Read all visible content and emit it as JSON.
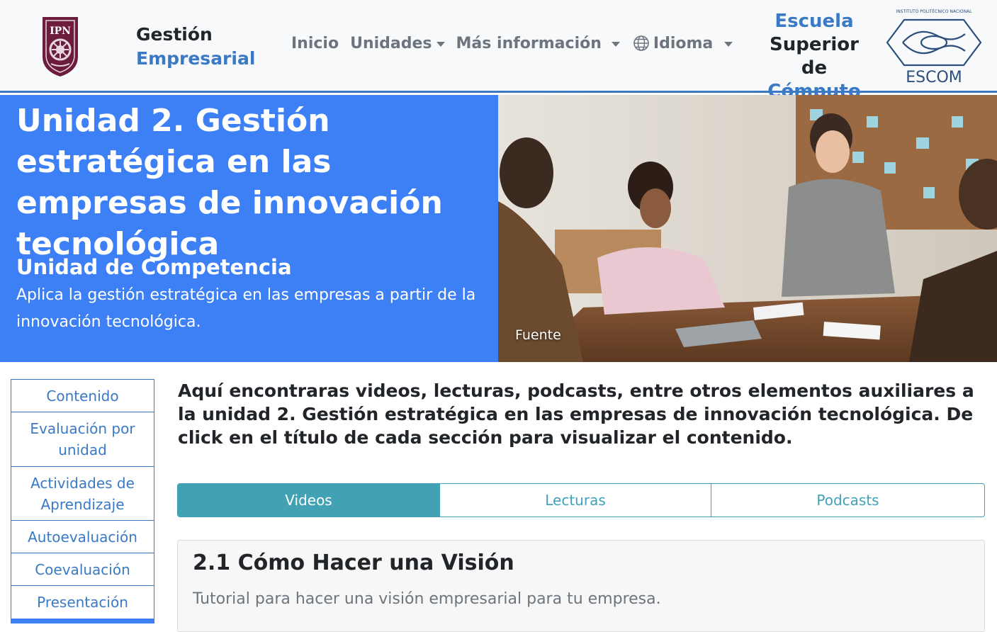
{
  "brand": {
    "line1": "Gestión",
    "line2": "Empresarial"
  },
  "nav": {
    "inicio": "Inicio",
    "unidades": "Unidades",
    "mas": "Más información",
    "idioma": "Idioma"
  },
  "escuela": {
    "line1": "Escuela",
    "line2": "Superior de",
    "line3": "Cómputo"
  },
  "escom": {
    "header": "INSTITUTO POLITÉCNICO NACIONAL",
    "name": "ESCOM"
  },
  "ipn_logo": {
    "text": "IPN"
  },
  "hero": {
    "title": "Unidad 2. Gestión estratégica en las empresas de innovación tecnológica",
    "subtitle": "Unidad de Competencia",
    "text": "Aplica la gestión estratégica en las empresas a partir de la innovación tecnológica.",
    "caption": "Fuente"
  },
  "sidebar": {
    "items": [
      {
        "label": "Contenido"
      },
      {
        "label": "Evaluación por unidad"
      },
      {
        "label": "Actividades de Aprendizaje"
      },
      {
        "label": "Autoevaluación"
      },
      {
        "label": "Coevaluación"
      },
      {
        "label": "Presentación"
      }
    ]
  },
  "main": {
    "intro": "Aquí encontraras videos, lecturas, podcasts, entre otros elementos auxiliares a la unidad 2. Gestión estratégica en las empresas de innovación tecnológica. De click en el título de cada sección para visualizar el contenido.",
    "tabs": [
      {
        "label": "Videos",
        "active": true
      },
      {
        "label": "Lecturas",
        "active": false
      },
      {
        "label": "Podcasts",
        "active": false
      }
    ],
    "card": {
      "title": "2.1 Cómo Hacer una Visión",
      "text": "Tutorial para hacer una visión empresarial para tu empresa."
    }
  },
  "colors": {
    "accent_blue": "#3a79c4",
    "hero_blue": "#3d7ff5",
    "tab_teal": "#42a2b3",
    "ipn_maroon": "#6d1d3c"
  },
  "icons": {
    "ipn_logo": "ipn-shield-logo",
    "escom_logo": "escom-logo",
    "globe": "globe-icon",
    "caret": "caret-down-icon"
  }
}
